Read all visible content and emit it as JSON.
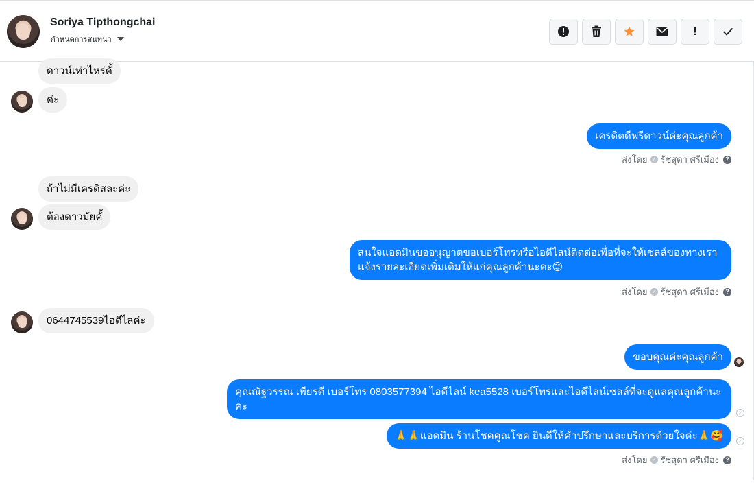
{
  "header": {
    "name": "Soriya Tipthongchai",
    "subtitle": "กำหนดการสนทนา"
  },
  "toolbar": {
    "icons": [
      "alert-circle-icon",
      "trash-icon",
      "star-icon",
      "envelope-icon",
      "exclamation-icon",
      "checkmark-icon"
    ],
    "star_color": "#f7923a"
  },
  "colors": {
    "outgoing": "#0a7cff",
    "incoming": "#f0f0f0"
  },
  "messages": [
    {
      "dir": "in",
      "text": "ดาวน์เท่าไหร่คั้"
    },
    {
      "dir": "in",
      "text": "ค่ะ"
    },
    {
      "dir": "out",
      "text": "เครดิตดีฟรีดาวน์ค่ะคุณลูกค้า"
    },
    {
      "dir": "in",
      "text": "ถ้าไม่มีเครดิสละค่ะ"
    },
    {
      "dir": "in",
      "text": "ต้องดาวมัยคั้"
    },
    {
      "dir": "out",
      "text": "สนใจแอดมินขออนุญาตขอเบอร์โทรหรือไอดีไลน์ติดต่อเพื่อที่จะให้เซลล์ของทางเราแจ้งรายละเอียดเพิ่มเติมให้แก่คุณลูกค้านะคะ😊"
    },
    {
      "dir": "in",
      "text": "0644745539ไอดีไลค่ะ"
    },
    {
      "dir": "out",
      "text": "ขอบคุณค่ะคุณลูกค้า"
    },
    {
      "dir": "out",
      "text": "คุณณัฐวรรณ เพียรดี       เบอร์โทร 0803577394  ไอดีไลน์ kea5528   เบอร์โทรและไอดีไลน์เซลล์ที่จะดูแลคุณลูกค้านะคะ"
    },
    {
      "dir": "out",
      "text": "🙏🙏แอดมิน ร้านโชคคูณโชค ยินดีให้คำปรึกษาและบริการด้วยใจค่ะ🙏🥰"
    }
  ],
  "sent_by": {
    "label": "ส่งโดย",
    "sender": "รัชสุดา ศรีเมือง",
    "help": "?"
  }
}
